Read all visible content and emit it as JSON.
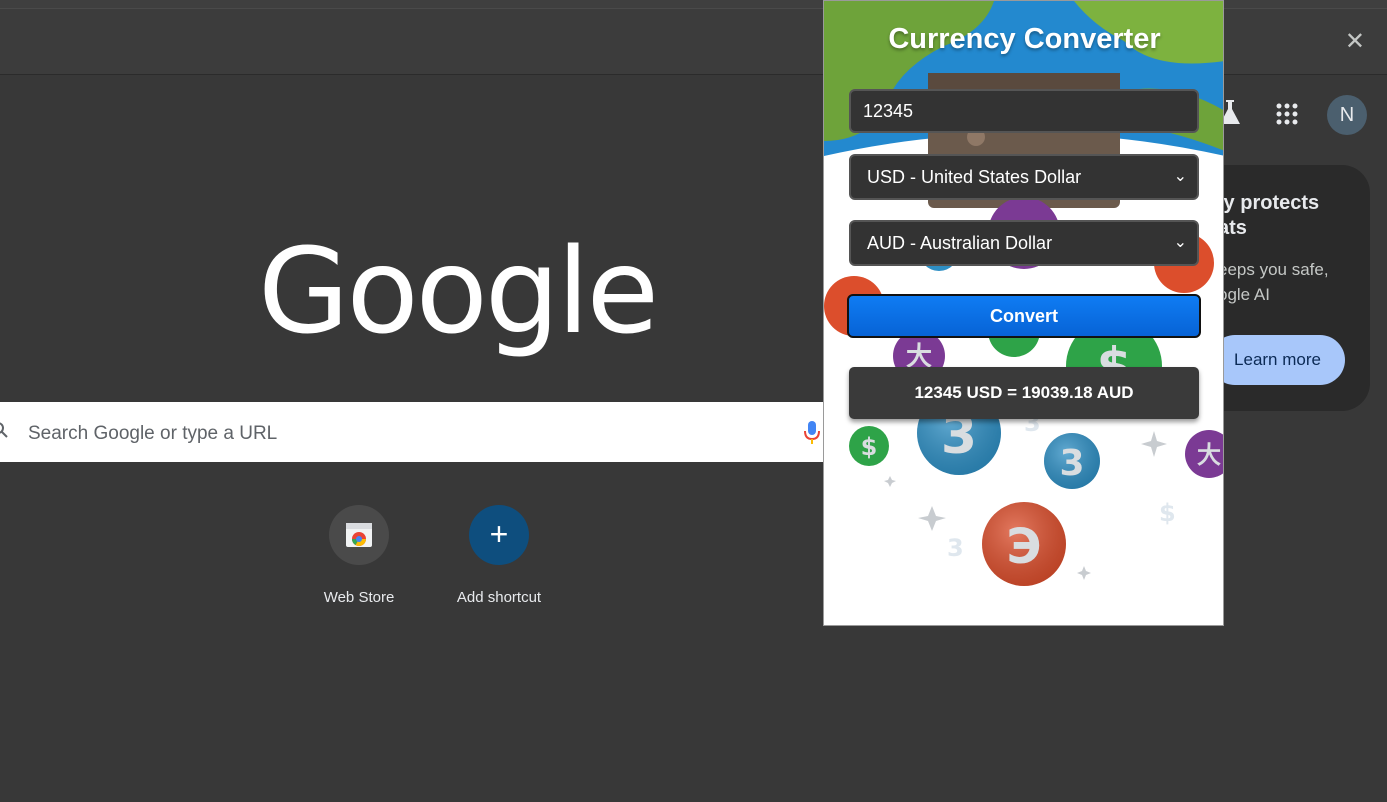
{
  "browser": {
    "close_label": "✕"
  },
  "ntp": {
    "logo_text": "Google",
    "search_placeholder": "Search Google or type a URL",
    "shortcuts": [
      {
        "label": "Web Store"
      },
      {
        "label": "Add shortcut"
      }
    ],
    "avatar_initial": "N",
    "promo": {
      "title": "ly protects\nats",
      "title_line1": "ly protects",
      "title_line2": "ats",
      "body_line1": "eeps you safe,",
      "body_line2": "ogle AI",
      "button_label": "Learn more"
    }
  },
  "extension": {
    "title": "Currency Converter",
    "amount_value": "12345",
    "from_currency": "USD - United States Dollar",
    "to_currency": "AUD - Australian Dollar",
    "convert_label": "Convert",
    "result": "12345 USD = 19039.18 AUD"
  },
  "colors": {
    "page_bg": "#383838",
    "convert_blue": "#0b6fe8",
    "promo_button": "#a8c7fa"
  }
}
